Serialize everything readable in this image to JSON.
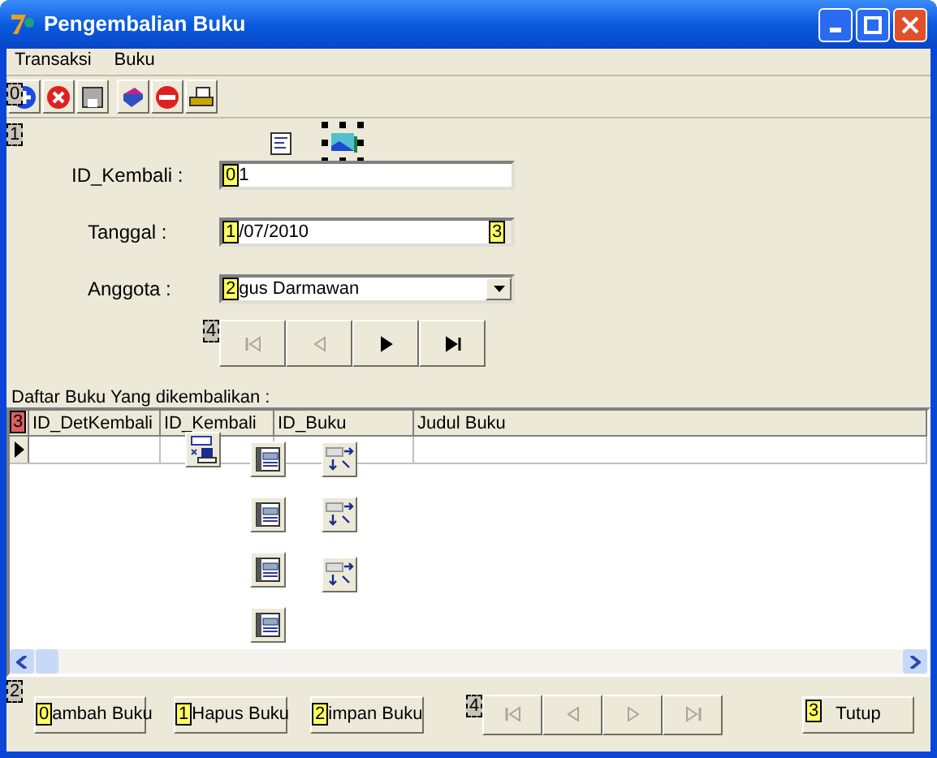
{
  "window": {
    "title": "Pengembalian Buku"
  },
  "menu": [
    {
      "label": "Transaksi"
    },
    {
      "label": "Buku"
    }
  ],
  "toolbar": {
    "badge": {
      "text": "0",
      "kind": "container"
    }
  },
  "top_panel": {
    "badge": {
      "text": "1",
      "kind": "container"
    }
  },
  "fields": [
    {
      "kind": "edit",
      "label": "ID_Kembali :",
      "badge": {
        "text": "0",
        "kind": "control"
      },
      "value": "1"
    },
    {
      "kind": "date",
      "label": "Tanggal :",
      "badge": {
        "text": "1",
        "kind": "control"
      },
      "value": "/07/2010",
      "button_badge": {
        "text": "3",
        "kind": "control"
      }
    },
    {
      "kind": "combo",
      "label": "Anggota :",
      "badge": {
        "text": "2",
        "kind": "control"
      },
      "value": "gus Darmawan"
    }
  ],
  "navigator": {
    "badge": {
      "text": "4",
      "kind": "container"
    },
    "buttons": [
      {
        "kind": "first",
        "disabled": true
      },
      {
        "kind": "prior",
        "disabled": true
      },
      {
        "kind": "next",
        "disabled": false
      },
      {
        "kind": "last",
        "disabled": false
      }
    ]
  },
  "grid_label": "Daftar Buku Yang dikembalikan :",
  "grid": {
    "badge": {
      "text": "3",
      "kind": "focused"
    },
    "columns": [
      "ID_DetKembali",
      "ID_Kembali",
      "ID_Buku",
      "Judul Buku"
    ]
  },
  "bottom_panel": {
    "badge": {
      "text": "2",
      "kind": "container"
    }
  },
  "bottom_buttons": [
    {
      "label": "ambah Buku",
      "badge": {
        "text": "0",
        "kind": "control"
      }
    },
    {
      "label": "Hapus Buku",
      "badge": {
        "text": "1",
        "kind": "control"
      }
    },
    {
      "label": "impan Buku",
      "badge": {
        "text": "2",
        "kind": "control"
      }
    }
  ],
  "bottom_navigator": {
    "badge": {
      "text": "4",
      "kind": "container"
    },
    "buttons": [
      {
        "kind": "first",
        "disabled": true
      },
      {
        "kind": "prior",
        "disabled": true
      },
      {
        "kind": "next",
        "disabled": true
      },
      {
        "kind": "last",
        "disabled": true
      }
    ]
  },
  "close_button": {
    "label": "Tutup",
    "badge": {
      "text": "3",
      "kind": "control"
    }
  }
}
